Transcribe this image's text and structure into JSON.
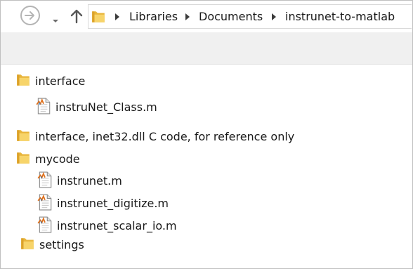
{
  "breadcrumb": [
    {
      "label": "Libraries"
    },
    {
      "label": "Documents"
    },
    {
      "label": "instrunet-to-matlab"
    }
  ],
  "tree": [
    {
      "label": "interface",
      "type": "folder"
    },
    {
      "label": "instruNet_Class.m",
      "type": "matlab-file"
    },
    {
      "label": "interface, inet32.dll C code, for reference only",
      "type": "folder"
    },
    {
      "label": "mycode",
      "type": "folder"
    },
    {
      "label": "instrunet.m",
      "type": "matlab-file"
    },
    {
      "label": "instrunet_digitize.m",
      "type": "matlab-file"
    },
    {
      "label": "instrunet_scalar_io.m",
      "type": "matlab-file"
    },
    {
      "label": "settings",
      "type": "folder"
    }
  ],
  "colors": {
    "folder": "#f2c94c",
    "folder_dark": "#d9a520",
    "toolbar_band": "#f0f0f0"
  }
}
